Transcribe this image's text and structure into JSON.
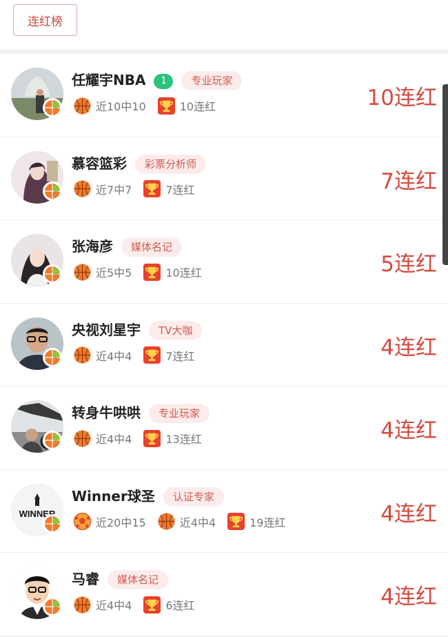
{
  "header": {
    "tab_label": "连红榜"
  },
  "rows": [
    {
      "name": "任耀宇NBA",
      "level": "1",
      "tag": "专业玩家",
      "stats": [
        {
          "icon": "basketball-icon",
          "text": "近10中10"
        },
        {
          "icon": "trophy-icon",
          "text": "10连红"
        }
      ],
      "streak": "10连红",
      "avatar": "avatar-photo-outdoor"
    },
    {
      "name": "慕容篮彩",
      "tag": "彩票分析师",
      "stats": [
        {
          "icon": "basketball-icon",
          "text": "近7中7"
        },
        {
          "icon": "trophy-icon",
          "text": "7连红"
        }
      ],
      "streak": "7连红",
      "avatar": "avatar-illustration"
    },
    {
      "name": "张海彦",
      "tag": "媒体名记",
      "stats": [
        {
          "icon": "basketball-icon",
          "text": "近5中5"
        },
        {
          "icon": "trophy-icon",
          "text": "10连红"
        }
      ],
      "streak": "5连红",
      "avatar": "avatar-portrait-woman"
    },
    {
      "name": "央视刘星宇",
      "tag": "TV大咖",
      "stats": [
        {
          "icon": "basketball-icon",
          "text": "近4中4"
        },
        {
          "icon": "trophy-icon",
          "text": "7连红"
        }
      ],
      "streak": "4连红",
      "avatar": "avatar-portrait-man-glasses"
    },
    {
      "name": "转身牛哄哄",
      "tag": "专业玩家",
      "stats": [
        {
          "icon": "basketball-icon",
          "text": "近4中4"
        },
        {
          "icon": "trophy-icon",
          "text": "13连红"
        }
      ],
      "streak": "4连红",
      "avatar": "avatar-photo-car"
    },
    {
      "name": "Winner球圣",
      "tag": "认证专家",
      "stats": [
        {
          "icon": "football-icon",
          "text": "近20中15"
        },
        {
          "icon": "basketball-icon",
          "text": "近4中4"
        },
        {
          "icon": "trophy-icon",
          "text": "19连红"
        }
      ],
      "streak": "4连红",
      "avatar": "avatar-winner-logo",
      "avatar_text": "WINNER"
    },
    {
      "name": "马睿",
      "tag": "媒体名记",
      "stats": [
        {
          "icon": "basketball-icon",
          "text": "近4中4"
        },
        {
          "icon": "trophy-icon",
          "text": "6连红"
        }
      ],
      "streak": "4连红",
      "avatar": "avatar-cartoon-man"
    }
  ],
  "colors": {
    "accent": "#d64a40",
    "tag_bg": "#fbeceb",
    "level_badge": "#2bc27a"
  }
}
